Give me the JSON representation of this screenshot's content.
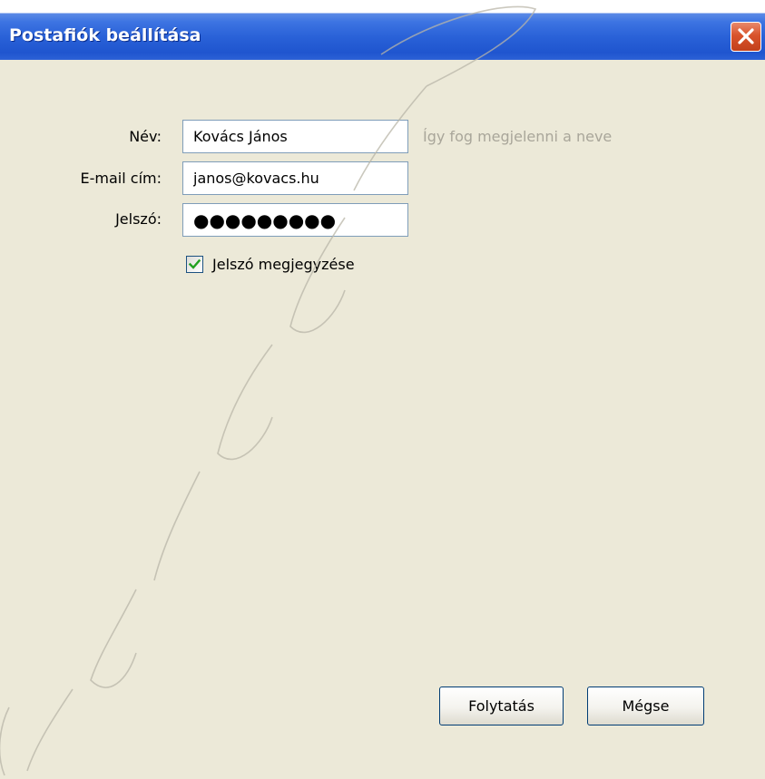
{
  "window": {
    "title": "Postafiók beállítása"
  },
  "form": {
    "name_label": "Név:",
    "name_value": "Kovács János",
    "name_hint": "Így fog megjelenni a neve",
    "email_label": "E-mail cím:",
    "email_value": "janos@kovacs.hu",
    "password_label": "Jelszó:",
    "password_mask": "●●●●●●●●●",
    "remember_label": "Jelszó megjegyzése",
    "remember_checked": true
  },
  "buttons": {
    "continue_label": "Folytatás",
    "cancel_label": "Mégse"
  },
  "icons": {
    "close": "close-icon",
    "check": "checkmark-icon"
  },
  "colors": {
    "titlebar": "#2a62d8",
    "close_button": "#d9532b",
    "dialog_background": "#ece9d8",
    "hint_text": "#a9a69a",
    "checkmark": "#21a121"
  }
}
